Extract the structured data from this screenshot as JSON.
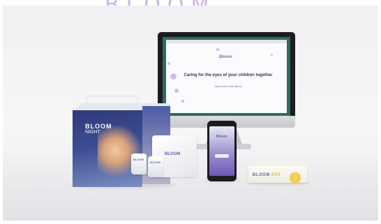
{
  "brand_strip": {
    "text": "BLOOM"
  },
  "monitor": {
    "logo": "Bloom",
    "heading": "Caring for the eyes of your children together",
    "subheading": "Now and in the future"
  },
  "box": {
    "logo_line1": "BLOOM",
    "logo_line2": "NIGHT"
  },
  "pouch": {
    "logo": "BLOOM"
  },
  "blisters": {
    "logo": "BLOOM"
  },
  "phone": {
    "logo": "Bloom"
  },
  "day_box": {
    "logo_bloom": "BLOOM",
    "logo_day": "DAY"
  },
  "colors": {
    "brand_purple": "#6c5fb0",
    "box_blue": "#2f3a7a",
    "day_yellow": "#e0b33f"
  }
}
